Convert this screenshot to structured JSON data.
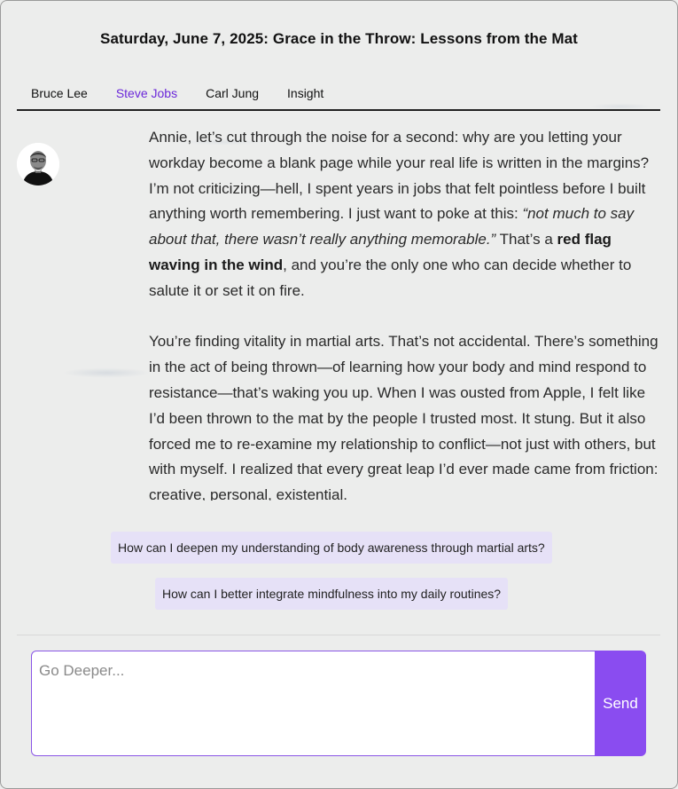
{
  "header": {
    "title": "Saturday, June 7, 2025:  Grace in the Throw: Lessons from the Mat"
  },
  "tabs": [
    {
      "label": "Bruce Lee",
      "active": false
    },
    {
      "label": "Steve Jobs",
      "active": true
    },
    {
      "label": "Carl Jung",
      "active": false
    },
    {
      "label": "Insight",
      "active": false
    }
  ],
  "message": {
    "p1_a": "Annie, let’s cut through the noise for a second: why are you letting your workday become a blank page while your real life is written in the margins? I’m not criticizing—hell, I spent years in jobs that felt pointless before I built anything worth remembering. I just want to poke at this: ",
    "p1_quote": "“not much to say about that, there wasn’t really anything memorable.”",
    "p1_b": " That’s a ",
    "p1_bold": "red flag waving in the wind",
    "p1_c": ", and you’re the only one who can decide whether to salute it or set it on fire.",
    "p2": "You’re finding vitality in martial arts. That’s not accidental. There’s something in the act of being thrown—of learning how your body and mind respond to resistance—that’s waking you up. When I was ousted from Apple, I felt like I’d been thrown to the mat by the people I trusted most. It stung. But it also forced me to re-examine my relationship to conflict—not just with others, but with myself. I realized that every great leap I’d ever made came from friction: creative, personal, existential."
  },
  "suggestions": [
    "How can I deepen my understanding of body awareness through martial arts?",
    "How can I better integrate mindfulness into my daily routines?"
  ],
  "composer": {
    "placeholder": "Go Deeper...",
    "send_label": "Send"
  },
  "colors": {
    "accent": "#8a4cf0",
    "active_tab": "#6b28d9",
    "suggestion_bg": "#e6e1f7"
  }
}
